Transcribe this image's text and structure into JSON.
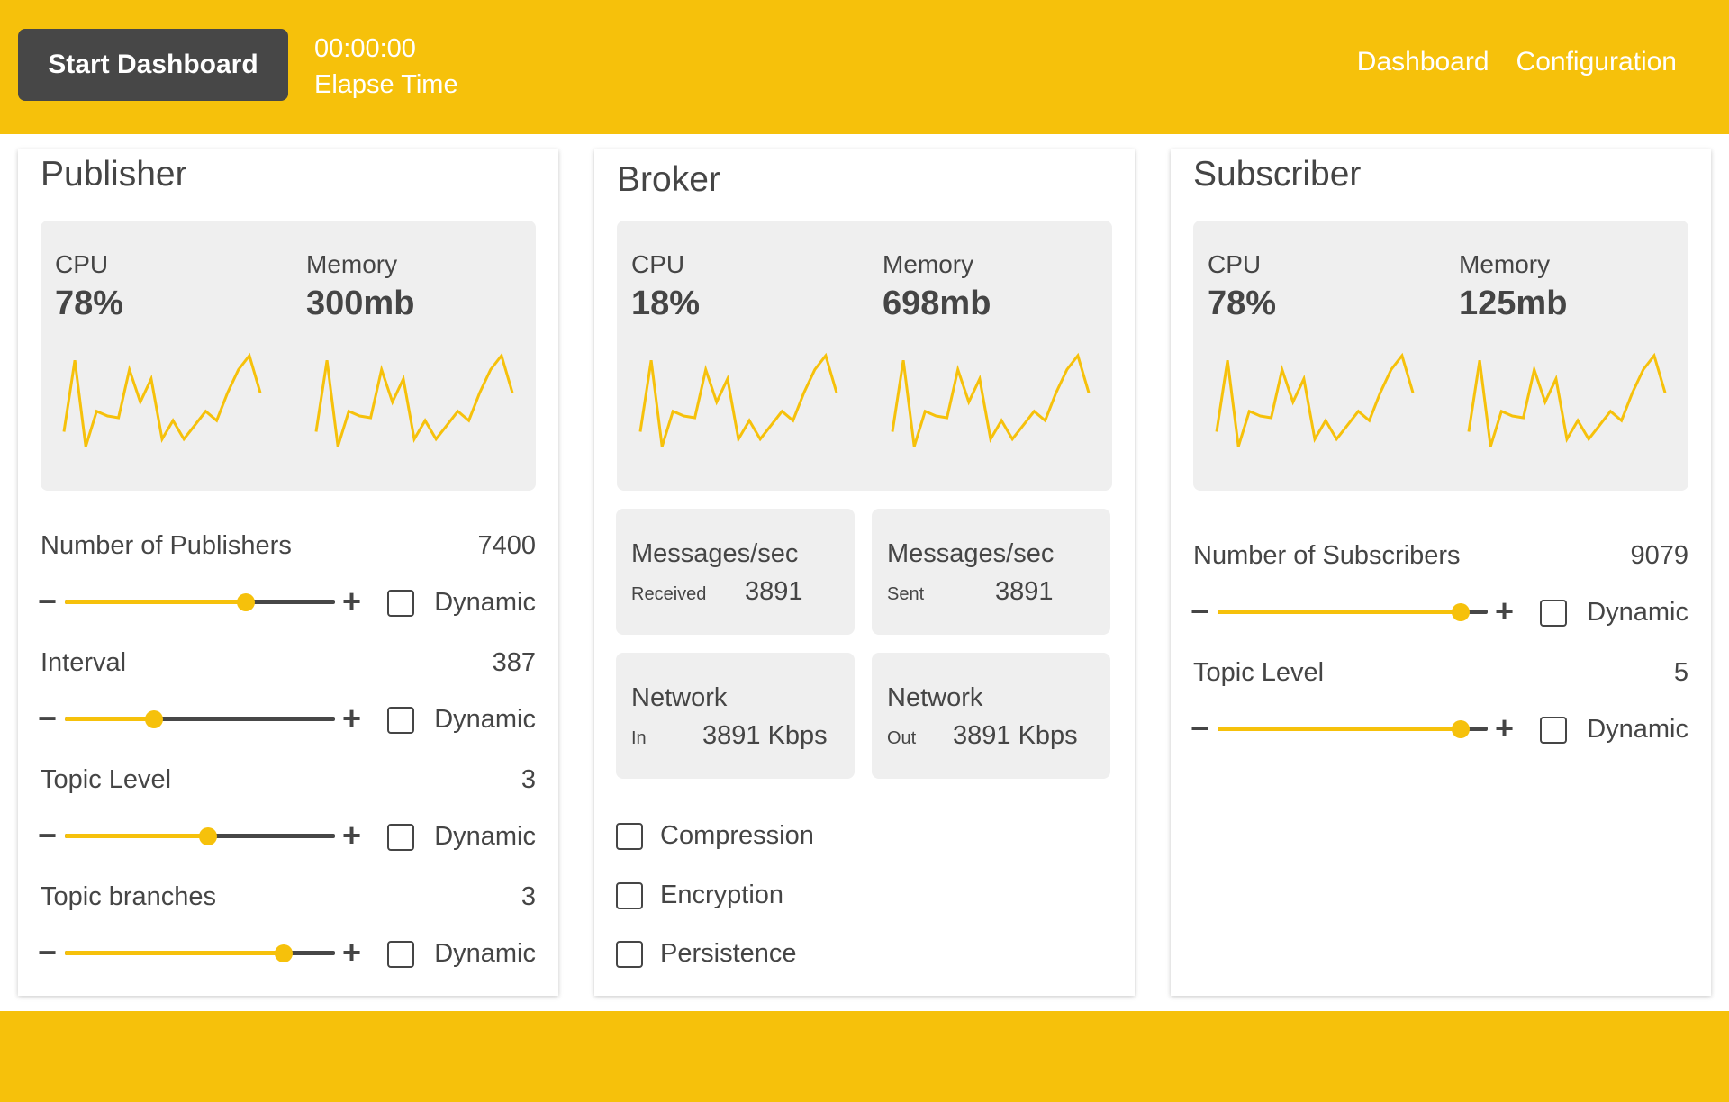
{
  "header": {
    "start_button": "Start Dashboard",
    "timer_value": "00:00:00",
    "timer_label": "Elapse Time",
    "nav": [
      "Dashboard",
      "Configuration"
    ]
  },
  "colors": {
    "accent": "#f6c10b",
    "dark": "#474747",
    "text": "#454545",
    "panel": "#efefef"
  },
  "publisher": {
    "title": "Publisher",
    "cpu_label": "CPU",
    "cpu_value": "78%",
    "memory_label": "Memory",
    "memory_value": "300mb",
    "params": [
      {
        "label": "Number of Publishers",
        "value": "7400",
        "level": 0.67,
        "dynamic_label": "Dynamic"
      },
      {
        "label": "Interval",
        "value": "387",
        "level": 0.33,
        "dynamic_label": "Dynamic"
      },
      {
        "label": "Topic Level",
        "value": "3",
        "level": 0.53,
        "dynamic_label": "Dynamic"
      },
      {
        "label": "Topic branches",
        "value": "3",
        "level": 0.81,
        "dynamic_label": "Dynamic"
      }
    ]
  },
  "broker": {
    "title": "Broker",
    "cpu_label": "CPU",
    "cpu_value": "18%",
    "memory_label": "Memory",
    "memory_value": "698mb",
    "tiles": [
      {
        "title": "Messages/sec",
        "sub": "Received",
        "value": "3891"
      },
      {
        "title": "Messages/sec",
        "sub": "Sent",
        "value": "3891"
      },
      {
        "title": "Network",
        "sub": "In",
        "value": "3891 Kbps"
      },
      {
        "title": "Network",
        "sub": "Out",
        "value": "3891 Kbps"
      }
    ],
    "options": [
      "Compression",
      "Encryption",
      "Persistence"
    ]
  },
  "subscriber": {
    "title": "Subscriber",
    "cpu_label": "CPU",
    "cpu_value": "78%",
    "memory_label": "Memory",
    "memory_value": "125mb",
    "params": [
      {
        "label": "Number of Subscribers",
        "value": "9079",
        "level": 0.9,
        "dynamic_label": "Dynamic"
      },
      {
        "label": "Topic Level",
        "value": "5",
        "level": 0.9,
        "dynamic_label": "Dynamic"
      }
    ]
  },
  "sparkline": [
    0.18,
    0.95,
    0.02,
    0.4,
    0.35,
    0.33,
    0.85,
    0.5,
    0.75,
    0.1,
    0.3,
    0.1,
    0.25,
    0.4,
    0.3,
    0.6,
    0.85,
    1.0,
    0.6
  ]
}
